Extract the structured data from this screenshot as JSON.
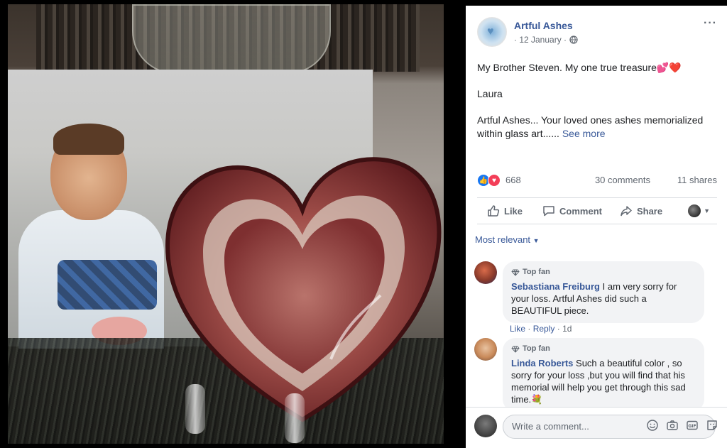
{
  "post": {
    "page_name": "Artful Ashes",
    "date": "· 12 January ·",
    "text_line1": "My Brother Steven. My one true treasure",
    "text_line1_emoji": "💕❤️",
    "text_line2": "Laura",
    "text_line3": "Artful Ashes... Your loved ones ashes memorialized within glass art......",
    "see_more": "See more",
    "more_icon": "···"
  },
  "stats": {
    "reaction_count": "668",
    "comments": "30 comments",
    "shares": "11 shares"
  },
  "actions": {
    "like": "Like",
    "comment": "Comment",
    "share": "Share"
  },
  "sort_label": "Most relevant",
  "comments": [
    {
      "badge": "Top fan",
      "name": "Sebastiana Freiburg",
      "text": "I am very sorry for your loss. Artful Ashes did such a BEAUTIFUL piece.",
      "like": "Like",
      "reply": "Reply",
      "time": "1d",
      "avatar_color": "#8a3a2a"
    },
    {
      "badge": "Top fan",
      "name": "Linda Roberts",
      "text": "Such a beautiful color , so sorry for your loss ,but you will find that his memorial will help you get through this sad time.",
      "emoji": "💐",
      "avatar_color": "#c98a5a"
    }
  ],
  "composer": {
    "placeholder": "Write a comment..."
  },
  "colors": {
    "link": "#385898",
    "like_blue": "#1877f2",
    "love_red": "#f33e58",
    "bubble": "#f2f3f5"
  }
}
